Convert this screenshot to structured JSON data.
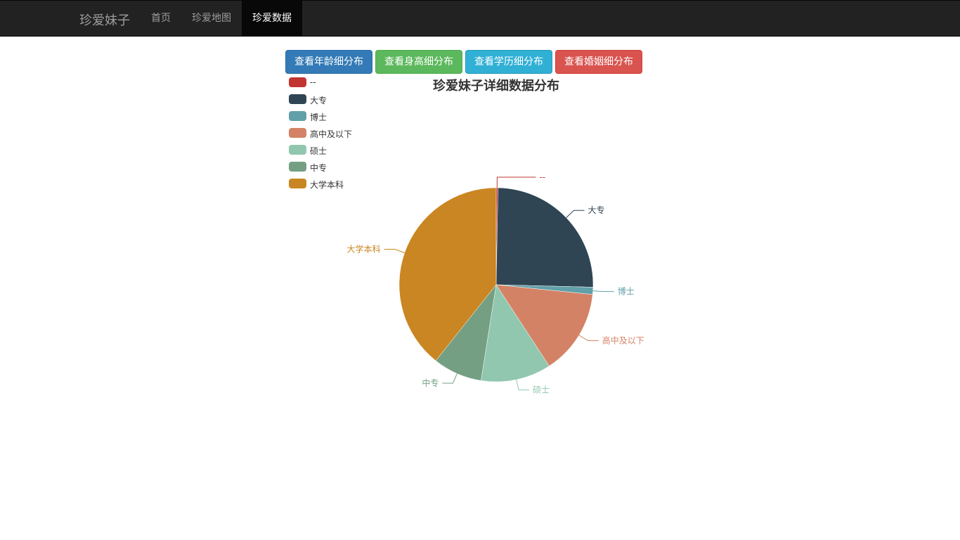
{
  "navbar": {
    "brand": "珍爱妹子",
    "items": [
      {
        "label": "首页"
      },
      {
        "label": "珍爱地图"
      },
      {
        "label": "珍爱数据",
        "active": true
      }
    ]
  },
  "buttons": [
    {
      "label": "查看年龄细分布",
      "color": "#337ab7"
    },
    {
      "label": "查看身高细分布",
      "color": "#5cb85c"
    },
    {
      "label": "查看学历细分布",
      "color": "#31b0d5"
    },
    {
      "label": "查看婚姻细分布",
      "color": "#d9534f"
    }
  ],
  "chart_data": {
    "type": "pie",
    "title": "珍爱妹子详细数据分布",
    "legend_position": "top-left",
    "categories": [
      "--",
      "大专",
      "博士",
      "高中及以下",
      "硕士",
      "中专",
      "大学本科"
    ],
    "values": [
      0.3,
      25.1,
      1.2,
      14.2,
      11.7,
      8.2,
      39.3
    ],
    "colors": [
      "#c23531",
      "#2f4554",
      "#61a0a8",
      "#d48265",
      "#91c7ae",
      "#749f83",
      "#ca8622"
    ]
  }
}
